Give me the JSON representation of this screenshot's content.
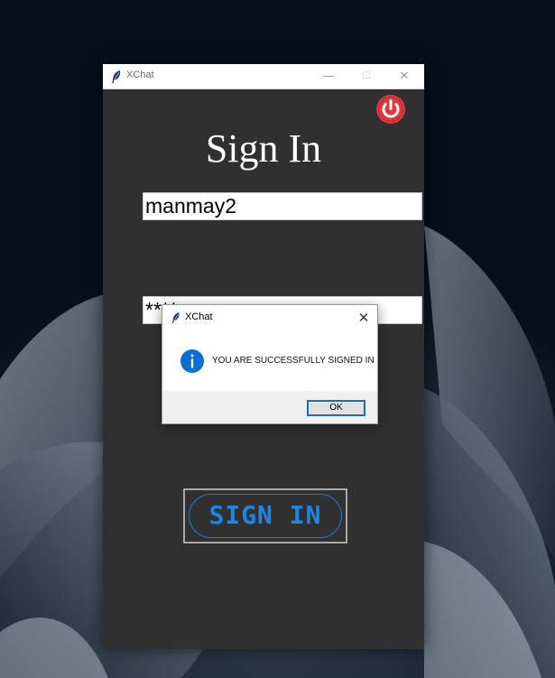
{
  "window": {
    "title": "XChat",
    "controls": {
      "minimize": "—",
      "maximize": "☐",
      "close": "✕"
    }
  },
  "page": {
    "heading": "Sign In"
  },
  "form": {
    "username_value": "manmay2",
    "password_value": "****"
  },
  "signin_button": {
    "label": "SIGN IN"
  },
  "dialog": {
    "title": "XChat",
    "close": "✕",
    "message": "YOU ARE SUCCESSFULLY SIGNED IN",
    "ok_label": "OK"
  },
  "colors": {
    "window_bg": "#303030",
    "accent_blue": "#1d86e2",
    "power_red": "#e0383e",
    "info_blue": "#0a6fd0"
  },
  "icons": {
    "app": "feather-icon",
    "power": "power-icon",
    "info": "info-icon"
  }
}
